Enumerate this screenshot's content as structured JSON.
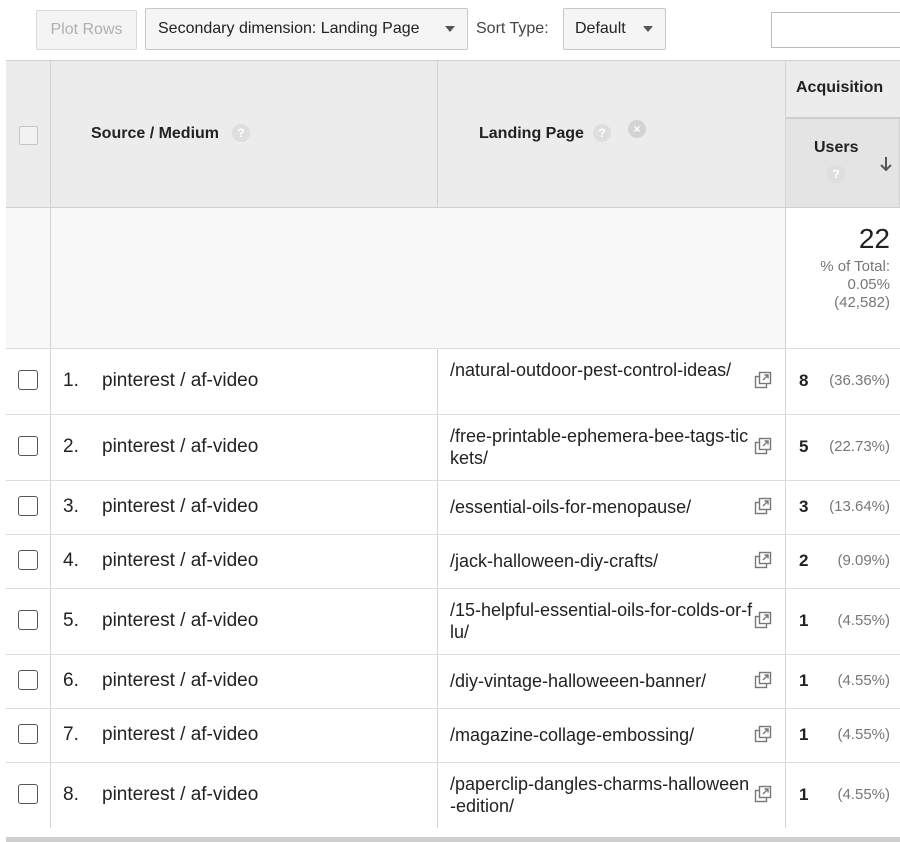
{
  "toolbar": {
    "plot_rows_label": "Plot Rows",
    "secondary_dimension_label": "Secondary dimension: Landing Page",
    "sort_type_label": "Sort Type:",
    "sort_type_value": "Default"
  },
  "table": {
    "headers": {
      "source_medium": "Source / Medium",
      "landing_page": "Landing Page",
      "acquisition": "Acquisition",
      "users": "Users",
      "help_glyph": "?",
      "remove_glyph": "×"
    },
    "totals": {
      "users": "22",
      "pct_label": "% of Total:",
      "pct": "0.05%",
      "abs": "(42,582)"
    },
    "rows": [
      {
        "index": "1.",
        "source": "pinterest / af-video",
        "landing": "/natural-outdoor-pest-control-ideas/",
        "users": "8",
        "pct": "(36.36%)"
      },
      {
        "index": "2.",
        "source": "pinterest / af-video",
        "landing": "/free-printable-ephemera-bee-tags-tickets/",
        "users": "5",
        "pct": "(22.73%)"
      },
      {
        "index": "3.",
        "source": "pinterest / af-video",
        "landing": "/essential-oils-for-menopause/",
        "users": "3",
        "pct": "(13.64%)"
      },
      {
        "index": "4.",
        "source": "pinterest / af-video",
        "landing": "/jack-halloween-diy-crafts/",
        "users": "2",
        "pct": "(9.09%)"
      },
      {
        "index": "5.",
        "source": "pinterest / af-video",
        "landing": "/15-helpful-essential-oils-for-colds-or-flu/",
        "users": "1",
        "pct": "(4.55%)"
      },
      {
        "index": "6.",
        "source": "pinterest / af-video",
        "landing": "/diy-vintage-halloweeen-banner/",
        "users": "1",
        "pct": "(4.55%)"
      },
      {
        "index": "7.",
        "source": "pinterest / af-video",
        "landing": "/magazine-collage-embossing/",
        "users": "1",
        "pct": "(4.55%)"
      },
      {
        "index": "8.",
        "source": "pinterest / af-video",
        "landing": "/paperclip-dangles-charms-halloween-edition/",
        "users": "1",
        "pct": "(4.55%)"
      }
    ]
  },
  "icons": {
    "external_link": "external-link-icon",
    "sort_desc": "arrow-down-icon",
    "help": "question-icon",
    "remove": "remove-circle-icon",
    "dropdown": "caret-down-icon"
  }
}
